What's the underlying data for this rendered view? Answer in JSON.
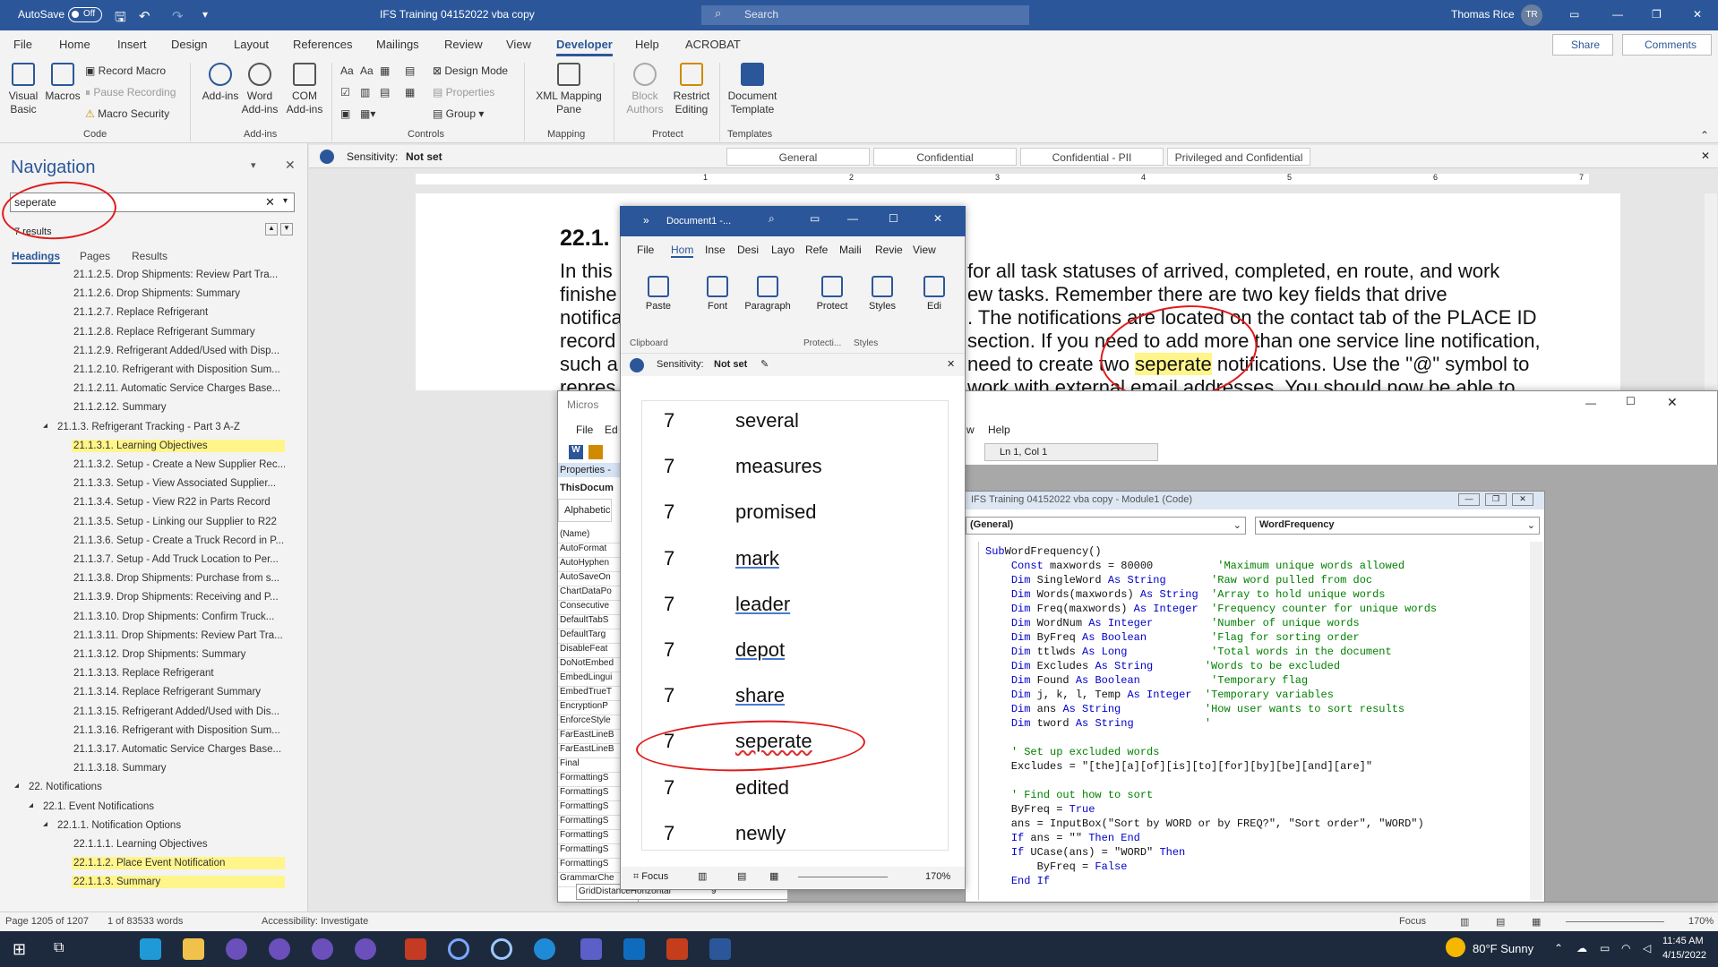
{
  "titlebar": {
    "autosave": "AutoSave",
    "autosave_state": "Off",
    "doc_title": "IFS Training 04152022 vba copy",
    "search_placeholder": "Search",
    "user": "Thomas Rice",
    "initials": "TR"
  },
  "tabs": [
    "File",
    "Home",
    "Insert",
    "Design",
    "Layout",
    "References",
    "Mailings",
    "Review",
    "View",
    "Developer",
    "Help",
    "ACROBAT"
  ],
  "active_tab": "Developer",
  "share": "Share",
  "comments": "Comments",
  "ribbon": {
    "code": {
      "label": "Code",
      "visual_basic": "Visual Basic",
      "macros": "Macros",
      "record": "Record Macro",
      "pause": "Pause Recording",
      "security": "Macro Security"
    },
    "addins": {
      "label": "Add-ins",
      "addins": "Add-ins",
      "word_addins": "Word Add-ins",
      "com_addins": "COM Add-ins"
    },
    "controls": {
      "label": "Controls",
      "aa1": "Aa",
      "aa2": "Aa",
      "design_mode": "Design Mode",
      "properties": "Properties",
      "group": "Group"
    },
    "mapping": {
      "label": "Mapping",
      "xml": "XML Mapping Pane"
    },
    "protect": {
      "label": "Protect",
      "block": "Block Authors",
      "restrict": "Restrict Editing"
    },
    "templates": {
      "label": "Templates",
      "doc_template": "Document Template"
    }
  },
  "nav": {
    "title": "Navigation",
    "query": "seperate",
    "results": "7 results",
    "tabs": [
      "Headings",
      "Pages",
      "Results"
    ],
    "items": [
      {
        "t": "21.1.2.5. Drop Shipments:  Review Part Tra...",
        "lvl": 3,
        "hl": false
      },
      {
        "t": "21.1.2.6. Drop Shipments: Summary",
        "lvl": 3,
        "hl": false
      },
      {
        "t": "21.1.2.7. Replace Refrigerant",
        "lvl": 3,
        "hl": false
      },
      {
        "t": "21.1.2.8. Replace Refrigerant Summary",
        "lvl": 3,
        "hl": false
      },
      {
        "t": "21.1.2.9. Refrigerant Added/Used with Disp...",
        "lvl": 3,
        "hl": false
      },
      {
        "t": "21.1.2.10. Refrigerant with Disposition Sum...",
        "lvl": 3,
        "hl": false
      },
      {
        "t": "21.1.2.11. Automatic Service Charges Base...",
        "lvl": 3,
        "hl": false
      },
      {
        "t": "21.1.2.12. Summary",
        "lvl": 3,
        "hl": false
      },
      {
        "t": "21.1.3. Refrigerant Tracking - Part 3 A-Z",
        "lvl": 2,
        "hl": false
      },
      {
        "t": "21.1.3.1. Learning Objectives",
        "lvl": 3,
        "hl": true
      },
      {
        "t": "21.1.3.2. Setup - Create a New Supplier Rec...",
        "lvl": 3,
        "hl": false
      },
      {
        "t": "21.1.3.3. Setup - View Associated Supplier...",
        "lvl": 3,
        "hl": false
      },
      {
        "t": "21.1.3.4. Setup - View R22 in Parts Record",
        "lvl": 3,
        "hl": false
      },
      {
        "t": "21.1.3.5. Setup - Linking our Supplier to R22",
        "lvl": 3,
        "hl": false
      },
      {
        "t": "21.1.3.6. Setup - Create a Truck Record in P...",
        "lvl": 3,
        "hl": false
      },
      {
        "t": "21.1.3.7. Setup - Add Truck Location to Per...",
        "lvl": 3,
        "hl": false
      },
      {
        "t": "21.1.3.8. Drop Shipments: Purchase from s...",
        "lvl": 3,
        "hl": false
      },
      {
        "t": "21.1.3.9. Drop Shipments: Receiving and P...",
        "lvl": 3,
        "hl": false
      },
      {
        "t": "21.1.3.10. Drop Shipments: Confirm Truck...",
        "lvl": 3,
        "hl": false
      },
      {
        "t": "21.1.3.11. Drop Shipments:  Review Part Tra...",
        "lvl": 3,
        "hl": false
      },
      {
        "t": "21.1.3.12. Drop Shipments: Summary",
        "lvl": 3,
        "hl": false
      },
      {
        "t": "21.1.3.13. Replace Refrigerant",
        "lvl": 3,
        "hl": false
      },
      {
        "t": "21.1.3.14. Replace Refrigerant Summary",
        "lvl": 3,
        "hl": false
      },
      {
        "t": "21.1.3.15. Refrigerant Added/Used with Dis...",
        "lvl": 3,
        "hl": false
      },
      {
        "t": "21.1.3.16. Refrigerant with Disposition Sum...",
        "lvl": 3,
        "hl": false
      },
      {
        "t": "21.1.3.17. Automatic Service Charges Base...",
        "lvl": 3,
        "hl": false
      },
      {
        "t": "21.1.3.18. Summary",
        "lvl": 3,
        "hl": false
      },
      {
        "t": "22. Notifications",
        "lvl": 0,
        "hl": false
      },
      {
        "t": "22.1. Event Notifications",
        "lvl": 1,
        "hl": false
      },
      {
        "t": "22.1.1. Notification Options",
        "lvl": 2,
        "hl": false
      },
      {
        "t": "22.1.1.1. Learning Objectives",
        "lvl": 3,
        "hl": false
      },
      {
        "t": "22.1.1.2. Place Event Notification",
        "lvl": 3,
        "hl": true
      },
      {
        "t": "22.1.1.3. Summary",
        "lvl": 3,
        "hl": true
      }
    ]
  },
  "sensitivity": {
    "label": "Sensitivity:",
    "value": "Not set",
    "chips": [
      "General",
      "Confidential",
      "Confidential - PII",
      "Privileged and Confidential"
    ]
  },
  "ruler": [
    "1",
    "2",
    "3",
    "4",
    "5",
    "6",
    "7"
  ],
  "doc": {
    "heading": "22.1.",
    "lines": [
      "In this",
      "finishe",
      "notifica",
      "record",
      "such a",
      "repres"
    ],
    "right": [
      "for all task statuses of arrived, completed, en route, and work",
      "ew tasks. Remember there are two key fields that drive",
      ". The notifications are located on the contact tab of the PLACE ID",
      "section. If you need to add more than one service line notification,",
      "need to create two ",
      "work with external email addresses. You should now be able to"
    ],
    "highlight": "seperate",
    "after": " notifications. Use the \"@\" symbol to"
  },
  "popup": {
    "title": "Document1 -...",
    "tabs": [
      "File",
      "Hom",
      "Inse",
      "Desi",
      "Layo",
      "Refe",
      "Maili",
      "Revie",
      "View"
    ],
    "groups": [
      {
        "name": "Paste",
        "sub": "Clipboard"
      },
      {
        "name": "Font",
        "sub": ""
      },
      {
        "name": "Paragraph",
        "sub": ""
      },
      {
        "name": "Protect",
        "sub": "Protecti..."
      },
      {
        "name": "Styles",
        "sub": "Styles"
      },
      {
        "name": "Edi",
        "sub": ""
      }
    ],
    "sens_label": "Sensitivity:",
    "sens_value": "Not set",
    "rows": [
      [
        "7",
        "several"
      ],
      [
        "7",
        "measures"
      ],
      [
        "7",
        "promised"
      ],
      [
        "7",
        "mark"
      ],
      [
        "7",
        "leader"
      ],
      [
        "7",
        "depot"
      ],
      [
        "7",
        "share"
      ],
      [
        "7",
        "seperate"
      ],
      [
        "7",
        "edited"
      ],
      [
        "7",
        "newly"
      ]
    ],
    "focus": "Focus",
    "zoom": "170%"
  },
  "vbe": {
    "title_left": "Micros",
    "menu_file": "File",
    "menu_edit": "Ed",
    "menu_w": "w",
    "menu_help": "Help",
    "position": "Ln 1, Col 1",
    "props_title": "Properties -",
    "props_obj": "ThisDocum",
    "props_tab": "Alphabetic",
    "props": [
      "(Name)",
      "AutoFormat",
      "AutoHyphen",
      "AutoSaveOn",
      "ChartDataPo",
      "Consecutive",
      "DefaultTabS",
      "DefaultTarg",
      "DisableFeat",
      "DoNotEmbed",
      "EmbedLingui",
      "EmbedTrueT",
      "EncryptionP",
      "EnforceStyle",
      "FarEastLineB",
      "FarEastLineB",
      "Final",
      "FormattingS",
      "FormattingS",
      "FormattingS",
      "FormattingS",
      "FormattingS",
      "FormattingS",
      "FormattingS",
      "GrammarChe",
      "GridDistanceHorizontal"
    ],
    "grid_value": "9",
    "module_title": "IFS Training 04152022 vba copy - Module1 (Code)",
    "combo1": "(General)",
    "combo2": "WordFrequency",
    "code": [
      [
        [
          "kw",
          "Sub"
        ],
        [
          "",
          "WordFrequency()"
        ]
      ],
      [
        [
          "",
          "    "
        ],
        [
          "kw",
          "Const"
        ],
        [
          "",
          " maxwords = 80000          "
        ],
        [
          "cm",
          "'Maximum unique words allowed"
        ]
      ],
      [
        [
          "",
          "    "
        ],
        [
          "kw",
          "Dim"
        ],
        [
          "",
          " SingleWord "
        ],
        [
          "kw",
          "As String"
        ],
        [
          "",
          "       "
        ],
        [
          "cm",
          "'Raw word pulled from doc"
        ]
      ],
      [
        [
          "",
          "    "
        ],
        [
          "kw",
          "Dim"
        ],
        [
          "",
          " Words(maxwords) "
        ],
        [
          "kw",
          "As String"
        ],
        [
          "",
          "  "
        ],
        [
          "cm",
          "'Array to hold unique words"
        ]
      ],
      [
        [
          "",
          "    "
        ],
        [
          "kw",
          "Dim"
        ],
        [
          "",
          " Freq(maxwords) "
        ],
        [
          "kw",
          "As Integer"
        ],
        [
          "",
          "  "
        ],
        [
          "cm",
          "'Frequency counter for unique words"
        ]
      ],
      [
        [
          "",
          "    "
        ],
        [
          "kw",
          "Dim"
        ],
        [
          "",
          " WordNum "
        ],
        [
          "kw",
          "As Integer"
        ],
        [
          "",
          "         "
        ],
        [
          "cm",
          "'Number of unique words"
        ]
      ],
      [
        [
          "",
          "    "
        ],
        [
          "kw",
          "Dim"
        ],
        [
          "",
          " ByFreq "
        ],
        [
          "kw",
          "As Boolean"
        ],
        [
          "",
          "          "
        ],
        [
          "cm",
          "'Flag for sorting order"
        ]
      ],
      [
        [
          "",
          "    "
        ],
        [
          "kw",
          "Dim"
        ],
        [
          "",
          " ttlwds "
        ],
        [
          "kw",
          "As Long"
        ],
        [
          "",
          "             "
        ],
        [
          "cm",
          "'Total words in the document"
        ]
      ],
      [
        [
          "",
          "    "
        ],
        [
          "kw",
          "Dim"
        ],
        [
          "",
          " Excludes "
        ],
        [
          "kw",
          "As String"
        ],
        [
          "",
          "        "
        ],
        [
          "cm",
          "'Words to be excluded"
        ]
      ],
      [
        [
          "",
          "    "
        ],
        [
          "kw",
          "Dim"
        ],
        [
          "",
          " Found "
        ],
        [
          "kw",
          "As Boolean"
        ],
        [
          "",
          "           "
        ],
        [
          "cm",
          "'Temporary flag"
        ]
      ],
      [
        [
          "",
          "    "
        ],
        [
          "kw",
          "Dim"
        ],
        [
          "",
          " j, k, l, Temp "
        ],
        [
          "kw",
          "As Integer"
        ],
        [
          "",
          "  "
        ],
        [
          "cm",
          "'Temporary variables"
        ]
      ],
      [
        [
          "",
          "    "
        ],
        [
          "kw",
          "Dim"
        ],
        [
          "",
          " ans "
        ],
        [
          "kw",
          "As String"
        ],
        [
          "",
          "             "
        ],
        [
          "cm",
          "'How user wants to sort results"
        ]
      ],
      [
        [
          "",
          "    "
        ],
        [
          "kw",
          "Dim"
        ],
        [
          "",
          " tword "
        ],
        [
          "kw",
          "As String"
        ],
        [
          "",
          "           "
        ],
        [
          "cm",
          "'"
        ]
      ],
      [
        [
          "",
          ""
        ]
      ],
      [
        [
          "",
          "    "
        ],
        [
          "cm",
          "' Set up excluded words"
        ]
      ],
      [
        [
          "",
          "    Excludes = \"[the][a][of][is][to][for][by][be][and][are]\""
        ]
      ],
      [
        [
          "",
          ""
        ]
      ],
      [
        [
          "",
          "    "
        ],
        [
          "cm",
          "' Find out how to sort"
        ]
      ],
      [
        [
          "",
          "    ByFreq = "
        ],
        [
          "kw",
          "True"
        ]
      ],
      [
        [
          "",
          "    ans = InputBox(\"Sort by WORD or by FREQ?\", \"Sort order\", \"WORD\")"
        ]
      ],
      [
        [
          "",
          "    "
        ],
        [
          "kw",
          "If"
        ],
        [
          "",
          " ans = \"\" "
        ],
        [
          "kw",
          "Then End"
        ]
      ],
      [
        [
          "",
          "    "
        ],
        [
          "kw",
          "If"
        ],
        [
          "",
          " UCase(ans) = \"WORD\" "
        ],
        [
          "kw",
          "Then"
        ]
      ],
      [
        [
          "",
          "        ByFreq = "
        ],
        [
          "kw",
          "False"
        ]
      ],
      [
        [
          "",
          "    "
        ],
        [
          "kw",
          "End If"
        ]
      ]
    ]
  },
  "status": {
    "page": "Page 1205 of 1207",
    "words": "1 of 83533 words",
    "access": "Accessibility: Investigate",
    "focus": "Focus",
    "zoom": "170%"
  },
  "taskbar": {
    "weather": "80°F  Sunny",
    "time": "11:45 AM",
    "date": "4/15/2022"
  },
  "colors": {
    "word_blue": "#2b579a",
    "highlight": "#fff58a",
    "annotation_red": "#e01b1b"
  }
}
